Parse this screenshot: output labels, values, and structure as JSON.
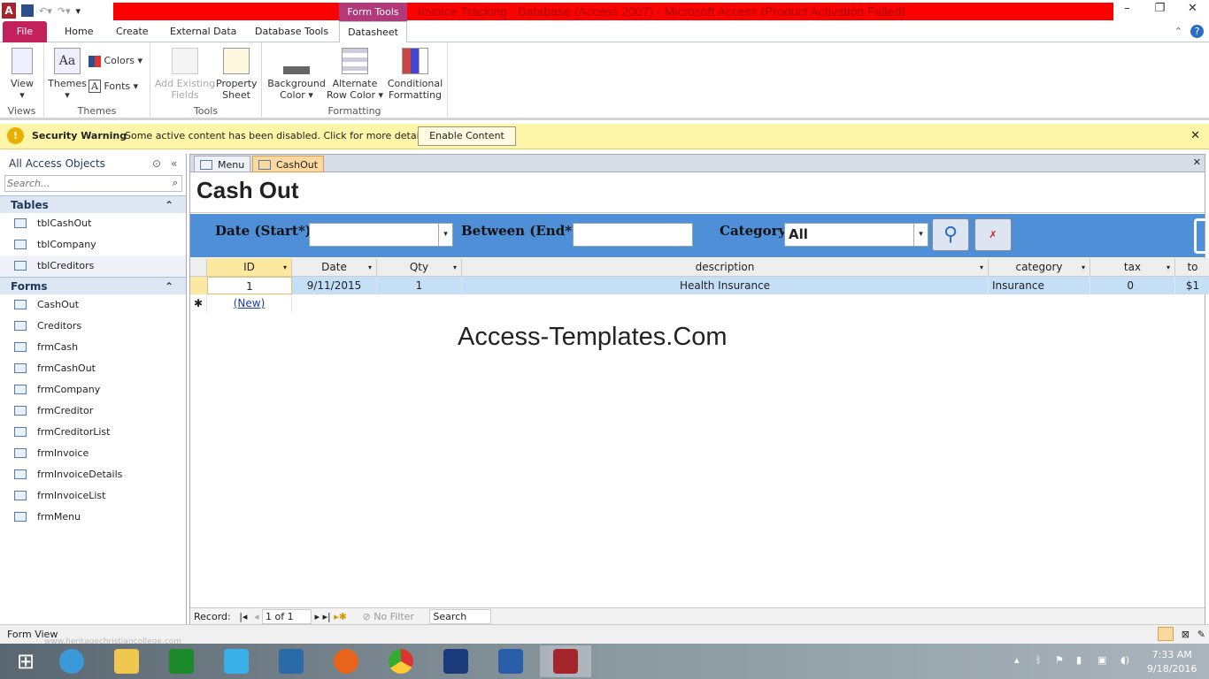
{
  "title": {
    "context_tab": "Form Tools",
    "window_title": "Invoice Tracking : Database (Access 2007) -  Microsoft Access (Product Activation Failed)"
  },
  "tabs": [
    "File",
    "Home",
    "Create",
    "External Data",
    "Database Tools",
    "Datasheet"
  ],
  "ribbon": {
    "view": "View",
    "themes": "Themes",
    "colors": "Colors",
    "fonts": "Fonts",
    "add_fields": "Add Existing Fields",
    "property_sheet": "Property Sheet",
    "background_color": "Background Color",
    "alt_row_color": "Alternate Row Color",
    "conditional": "Conditional Formatting",
    "groups": [
      "Views",
      "Themes",
      "Tools",
      "Formatting"
    ]
  },
  "security": {
    "title": "Security Warning",
    "message": "Some active content has been disabled. Click for more details.",
    "button": "Enable Content"
  },
  "nav": {
    "header": "All Access Objects",
    "search_placeholder": "Search...",
    "tables_label": "Tables",
    "tables": [
      "tblCashOut",
      "tblCompany",
      "tblCreditors"
    ],
    "forms_label": "Forms",
    "forms": [
      "CashOut",
      "Creditors",
      "frmCash",
      "frmCashOut",
      "frmCompany",
      "frmCreditor",
      "frmCreditorList",
      "frmInvoice",
      "frmInvoiceDetails",
      "frmInvoiceList",
      "frmMenu"
    ]
  },
  "doc_tabs": [
    "Menu",
    "CashOut"
  ],
  "form": {
    "title": "Cash Out",
    "date_start_label": "Date (Start*)",
    "date_end_label": "Between (End*)",
    "category_label": "Category",
    "category_value": "All",
    "watermark": "Access-Templates.Com"
  },
  "grid": {
    "columns": [
      "ID",
      "Date",
      "Qty",
      "description",
      "category",
      "tax",
      "to"
    ],
    "rows": [
      [
        "1",
        "9/11/2015",
        "1",
        "Health Insurance",
        "Insurance",
        "0",
        "$1"
      ]
    ],
    "new_row": "(New)"
  },
  "recnav": {
    "label": "Record:",
    "position": "1 of 1",
    "filter": "No Filter",
    "search": "Search"
  },
  "status": {
    "text": "Form View",
    "site_watermark": "www.heritagechristiancollege.com"
  },
  "clock": {
    "time": "7:33 AM",
    "date": "9/18/2016"
  },
  "colors": {
    "accent": "#c3215c",
    "filter_bar": "#4f8fd8",
    "title_bar": "#ff0000"
  }
}
